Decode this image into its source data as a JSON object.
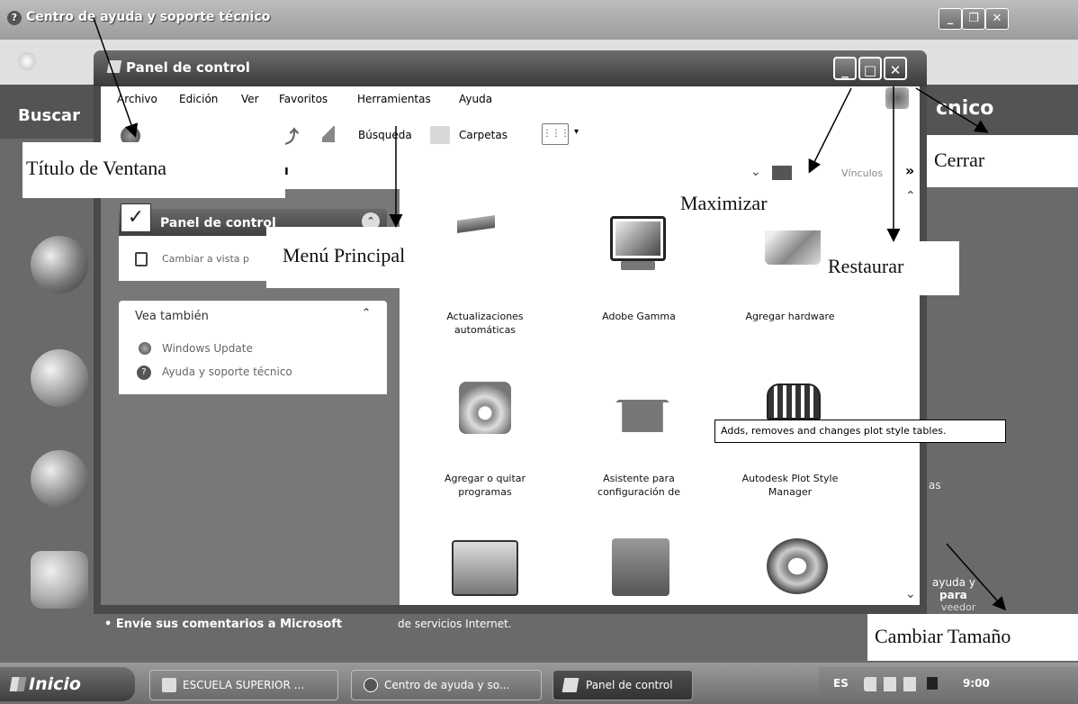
{
  "background_window": {
    "title": "Centro de ayuda y soporte técnico",
    "left_heading": "Buscar",
    "right_heading_fragment": "cnico",
    "bullet_link": "Envíe sus comentarios a Microsoft",
    "isp_text": "de servicios Internet.",
    "right_text_1": "ayuda y",
    "right_text_2": "para",
    "right_text_3": "veedor",
    "right_text_4": "as"
  },
  "window": {
    "title": "Panel de control",
    "menu": [
      "Archivo",
      "Edición",
      "Ver",
      "Favoritos",
      "Herramientas",
      "Ayuda"
    ],
    "toolbar": {
      "search_label": "Búsqueda",
      "folders_label": "Carpetas"
    },
    "address": {
      "links_label": "Vínculos",
      "more": "»"
    },
    "left_pane": {
      "panel_title": "Panel de control",
      "switch_view_link": "Cambiar a vista p",
      "see_also_title": "Vea también",
      "see_also_items": [
        "Windows Update",
        "Ayuda y soporte técnico"
      ]
    },
    "items": [
      {
        "label": "Actualizaciones automáticas",
        "icon": "update-icon"
      },
      {
        "label": "Adobe Gamma",
        "icon": "monitor-icon"
      },
      {
        "label": "Agregar hardware",
        "icon": "hardware-icon"
      },
      {
        "label": "Agregar o quitar programas",
        "icon": "cd-box-icon"
      },
      {
        "label": "Asistente para configuración de",
        "icon": "house-icon"
      },
      {
        "label": "Autodesk Plot Style Manager",
        "icon": "plot-style-icon"
      }
    ],
    "tooltip": "Adds, removes and changes plot style tables."
  },
  "annotations": {
    "titulo": "Título de Ventana",
    "menu": "Menú Principal",
    "maximizar": "Maximizar",
    "restaurar": "Restaurar",
    "cerrar": "Cerrar",
    "tamano": "Cambiar Tamaño"
  },
  "taskbar": {
    "start": "Inicio",
    "tasks": [
      "ESCUELA SUPERIOR ...",
      "Centro de ayuda y so...",
      "Panel de control"
    ],
    "language": "ES",
    "clock": "9:00"
  }
}
